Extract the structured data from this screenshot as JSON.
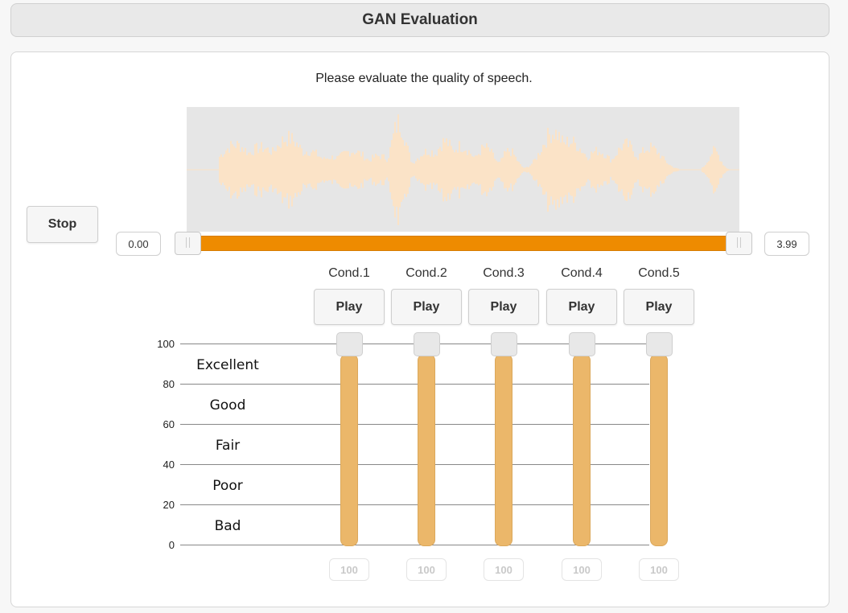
{
  "header": {
    "title": "GAN Evaluation"
  },
  "instruction": "Please evaluate the quality of speech.",
  "player": {
    "stop_label": "Stop",
    "start_time": "0.00",
    "end_time": "3.99",
    "progress": 1.0,
    "waveform_color": "#fbe3c7",
    "track_color": "#ee8b00"
  },
  "conditions": [
    {
      "label": "Cond.1",
      "play_label": "Play",
      "score": "100"
    },
    {
      "label": "Cond.2",
      "play_label": "Play",
      "score": "100"
    },
    {
      "label": "Cond.3",
      "play_label": "Play",
      "score": "100"
    },
    {
      "label": "Cond.4",
      "play_label": "Play",
      "score": "100"
    },
    {
      "label": "Cond.5",
      "play_label": "Play",
      "score": "100"
    }
  ],
  "scale": {
    "ticks": [
      "100",
      "80",
      "60",
      "40",
      "20",
      "0"
    ],
    "labels": [
      "Excellent",
      "Good",
      "Fair",
      "Poor",
      "Bad"
    ],
    "slider_color": "#ebb76a"
  }
}
